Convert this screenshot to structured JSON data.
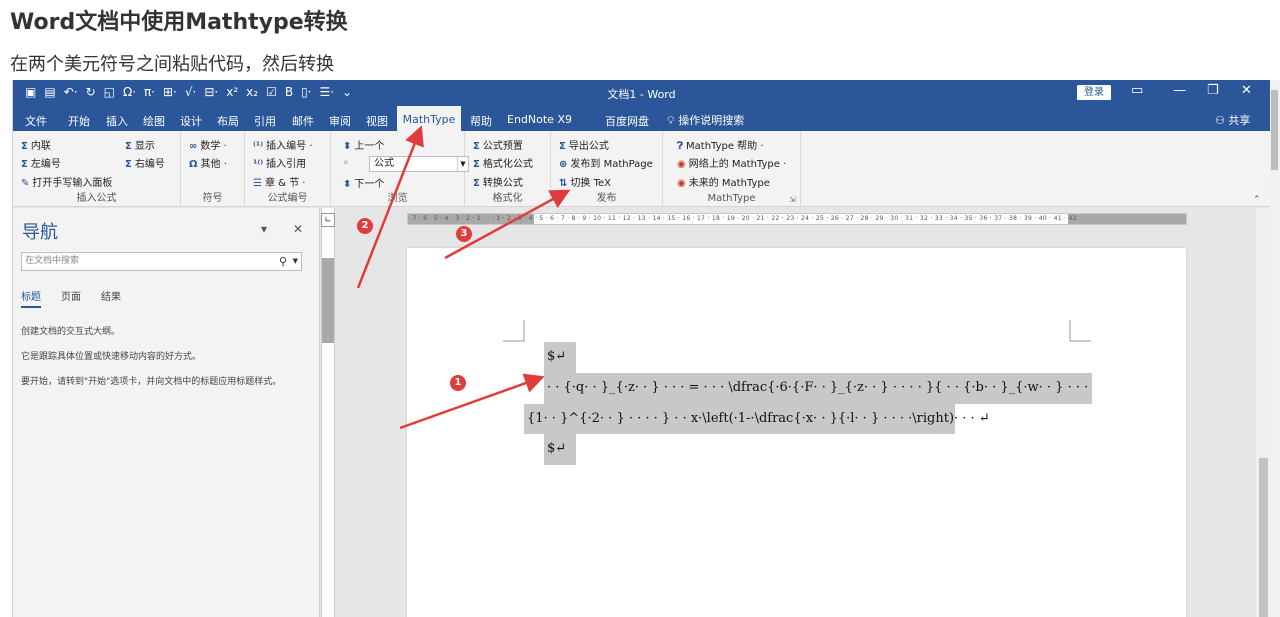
{
  "article": {
    "title": "Word文档中使用Mathtype转换",
    "subtitle": "在两个美元符号之间粘贴代码，然后转换"
  },
  "titlebar": {
    "title": "文档1 - Word",
    "login": "登录"
  },
  "tabs": [
    "文件",
    "开始",
    "插入",
    "绘图",
    "设计",
    "布局",
    "引用",
    "邮件",
    "审阅",
    "视图",
    "MathType",
    "帮助",
    "EndNote X9",
    "百度网盘"
  ],
  "active_tab": "MathType",
  "tell_me": "操作说明搜索",
  "share": "共享",
  "ribbon": {
    "insert_equation": {
      "label": "插入公式",
      "inline": "内联",
      "display": "显示",
      "left_numbered": "左编号",
      "right_numbered": "右编号",
      "handwriting": "打开手写输入面板"
    },
    "symbols": {
      "label": "符号",
      "math": "数学",
      "other": "其他"
    },
    "numbering": {
      "label": "公式编号",
      "insert_number": "插入编号",
      "insert_ref": "插入引用",
      "chapter": "章 & 节"
    },
    "browse": {
      "label": "浏览",
      "prev": "上一个",
      "combo": "公式",
      "next": "下一个"
    },
    "format": {
      "label": "格式化",
      "preferences": "公式预置",
      "format_eq": "格式化公式",
      "convert": "转换公式"
    },
    "publish": {
      "label": "发布",
      "export": "导出公式",
      "mathpage": "发布到 MathPage",
      "toggle_tex": "切换 TeX"
    },
    "mathtype": {
      "label": "MathType",
      "help": "MathType 帮助",
      "online": "网络上的 MathType",
      "future": "未来的 MathType"
    }
  },
  "nav": {
    "title": "导航",
    "search_placeholder": "在文档中搜索",
    "tabs": [
      "标题",
      "页面",
      "结果"
    ],
    "p1": "创建文档的交互式大纲。",
    "p2": "它是跟踪具体位置或快速移动内容的好方式。",
    "p3": "要开始，请转到\"开始\"选项卡，并向文档中的标题应用标题样式。"
  },
  "ruler": {
    "numbers": "· 7 · 6 · 5 · 4 · 3 · 2 · 1 · · · 1 · 2 · 3 · 4 · 5 · 6 · 7 · 8 · 9 · 10 · 11 · 12 · 13 · 14 · 15 · 16 · 17 · 18 · 19 · 20 · 21 · 22 · 23 · 24 · 25 · 26 · 27 · 28 · 29 · 30 · 31 · 32 · 33 · 34 · 35 · 36 · 37 · 38 · 39 · 40 · 41 · 42"
  },
  "document": {
    "line1": "$↵",
    "line2": "· · {·q· · }_{·z· · } · · · = · · · \\dfrac{·6·{·F· · }_{·z· · } · · · · }{ · · {·b· · }_{·w· · } · · ·",
    "line3": "{1· · }^{·2· · } · · · · } · · x·\\left(·1-·\\dfrac{·x· · }{·l· · } · · · ·\\right)· · · ↵",
    "line4": "$↵"
  },
  "annotations": [
    "1",
    "2",
    "3"
  ],
  "colors": {
    "word_blue": "#2b579a",
    "arrow_red": "#e03c3c",
    "selection": "#c8c8c8"
  }
}
